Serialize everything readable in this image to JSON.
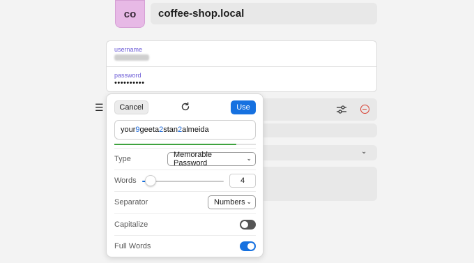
{
  "header": {
    "avatar_text": "co",
    "site_title": "coffee-shop.local"
  },
  "credentials": {
    "username_label": "username",
    "password_label": "password",
    "password_mask": "••••••••••"
  },
  "generator": {
    "cancel_label": "Cancel",
    "use_label": "Use",
    "password_parts": [
      {
        "text": "your",
        "digit": false
      },
      {
        "text": "9",
        "digit": true
      },
      {
        "text": "geeta",
        "digit": false
      },
      {
        "text": "2",
        "digit": true
      },
      {
        "text": "stan",
        "digit": false
      },
      {
        "text": "2",
        "digit": true
      },
      {
        "text": "almeida",
        "digit": false
      }
    ],
    "strength_fraction": 0.86,
    "strength_color": "#3fa33f",
    "options": {
      "type_label": "Type",
      "type_value": "Memorable Password",
      "words_label": "Words",
      "words_value": "4",
      "words_slider_fraction": 0.1,
      "separator_label": "Separator",
      "separator_value": "Numbers",
      "capitalize_label": "Capitalize",
      "capitalize_on": false,
      "fullwords_label": "Full Words",
      "fullwords_on": true
    }
  },
  "colors": {
    "accent": "#1671e0",
    "danger": "#d73a2c",
    "label_purple": "#6b5bd6"
  },
  "icons": [
    "menu-icon",
    "refresh-icon",
    "sliders-icon",
    "remove-circle-icon",
    "chevron-down-icon"
  ]
}
